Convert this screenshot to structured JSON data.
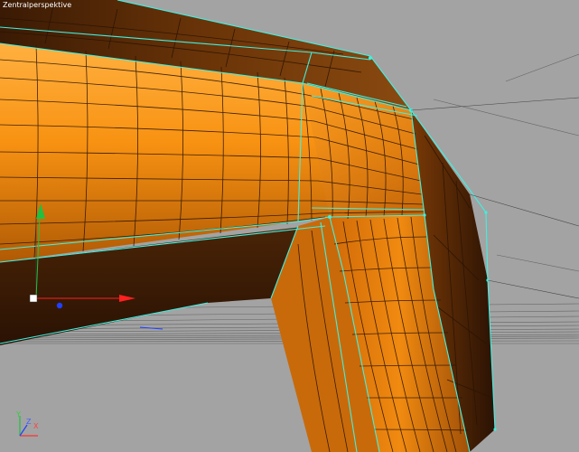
{
  "viewport": {
    "title": "Zentralperspektive",
    "axis_labels": {
      "x": "X",
      "y": "Y",
      "z": "Z"
    }
  },
  "colors": {
    "background": "#a3a3a3",
    "mesh_orange": "#f08a10",
    "mesh_dark": "#3a1c05",
    "selection_cyan": "#40f0e0",
    "axis_x": "#ff3030",
    "axis_y": "#20c040",
    "axis_z": "#2040ff"
  },
  "icons": [
    "move-gizmo-icon",
    "axis-orientation-icon"
  ]
}
